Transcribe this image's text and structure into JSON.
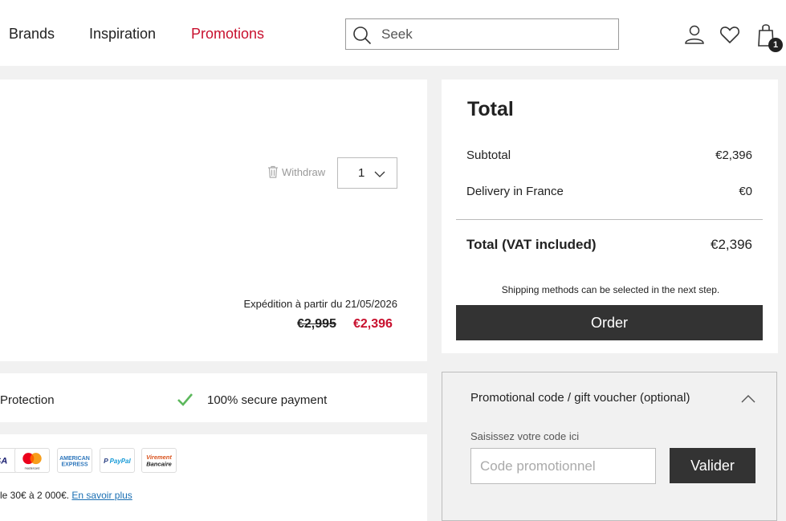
{
  "header": {
    "nav": [
      {
        "label": "Brands"
      },
      {
        "label": "Inspiration"
      },
      {
        "label": "Promotions"
      }
    ],
    "search": {
      "placeholder": "Seek",
      "icon": "search-icon"
    },
    "icons": {
      "account": "user-icon",
      "wishlist": "heart-icon",
      "cart": "shopping-bag-icon"
    },
    "cart_count": "1",
    "accent_color": "#c8102e"
  },
  "product": {
    "withdraw_label": "Withdraw",
    "quantity": "1",
    "shipping_date": "Expédition à partir du 21/05/2026",
    "old_price": "€2,995",
    "new_price": "€2,396"
  },
  "reassurance": {
    "protection_label": "Protection",
    "secure_payment_label": "100% secure payment"
  },
  "payment": {
    "methods": [
      "VISA",
      "Mastercard",
      "American Express",
      "PayPal",
      "Virement Bancaire"
    ],
    "financing_text": "le 30€ à 2 000€.",
    "learn_more_link": "En savoir plus"
  },
  "total": {
    "title": "Total",
    "subtotal_label": "Subtotal",
    "subtotal_value": "€2,396",
    "delivery_label": "Delivery in France",
    "delivery_value": "€0",
    "total_label": "Total (VAT included)",
    "total_value": "€2,396",
    "shipping_note": "Shipping methods can be selected in the next step.",
    "order_button": "Order"
  },
  "promo": {
    "title": "Promotional code / gift voucher (optional)",
    "field_label": "Saisissez votre code ici",
    "placeholder": "Code promotionnel",
    "submit_button": "Valider"
  }
}
